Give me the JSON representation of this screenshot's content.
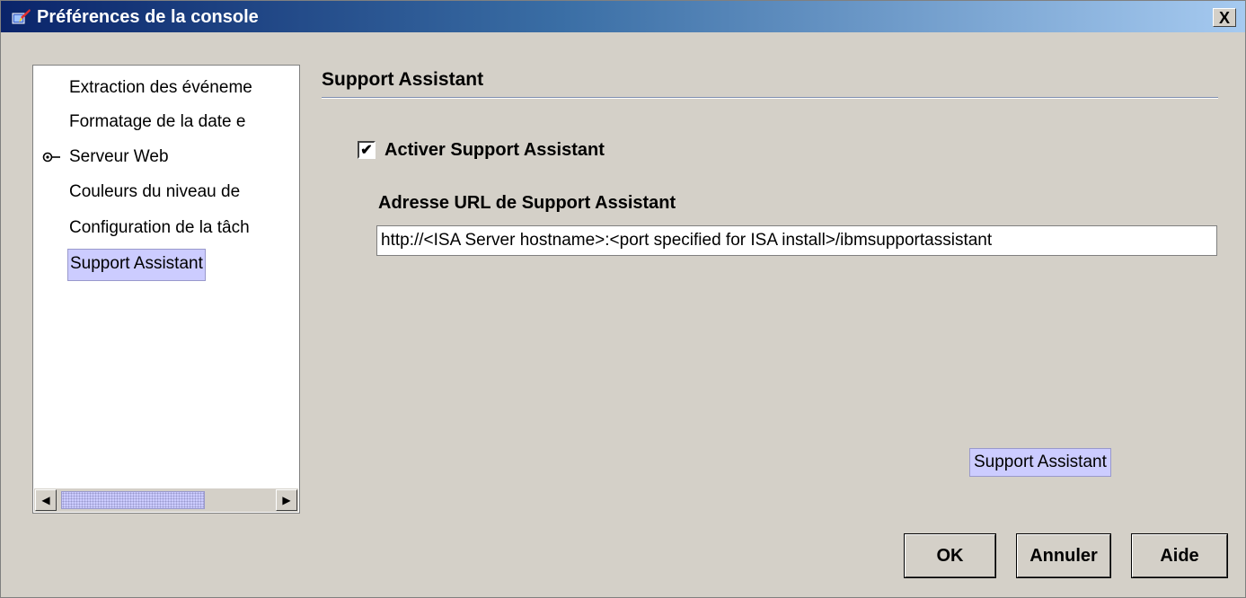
{
  "window": {
    "title": "Préférences de la console",
    "close_label": "X"
  },
  "nav": {
    "items": [
      {
        "label": "Extraction des événeme",
        "selected": false,
        "has_radio": false
      },
      {
        "label": "Formatage de la date e",
        "selected": false,
        "has_radio": false
      },
      {
        "label": "Serveur Web",
        "selected": false,
        "has_radio": true
      },
      {
        "label": "Couleurs du niveau de",
        "selected": false,
        "has_radio": false
      },
      {
        "label": "Configuration de la tâch",
        "selected": false,
        "has_radio": false
      },
      {
        "label": "Support Assistant",
        "selected": true,
        "has_radio": false
      }
    ]
  },
  "section": {
    "title": "Support Assistant",
    "enable_label": "Activer Support Assistant",
    "enable_checked": true,
    "url_label": "Adresse URL de Support Assistant",
    "url_value": "http://<ISA Server hostname>:<port specified for ISA install>/ibmsupportassistant",
    "link_label": "Support Assistant"
  },
  "buttons": {
    "ok": "OK",
    "cancel": "Annuler",
    "help": "Aide"
  },
  "colors": {
    "selection": "#ccccff",
    "title_start": "#0a246a",
    "title_end": "#a6caf0"
  }
}
